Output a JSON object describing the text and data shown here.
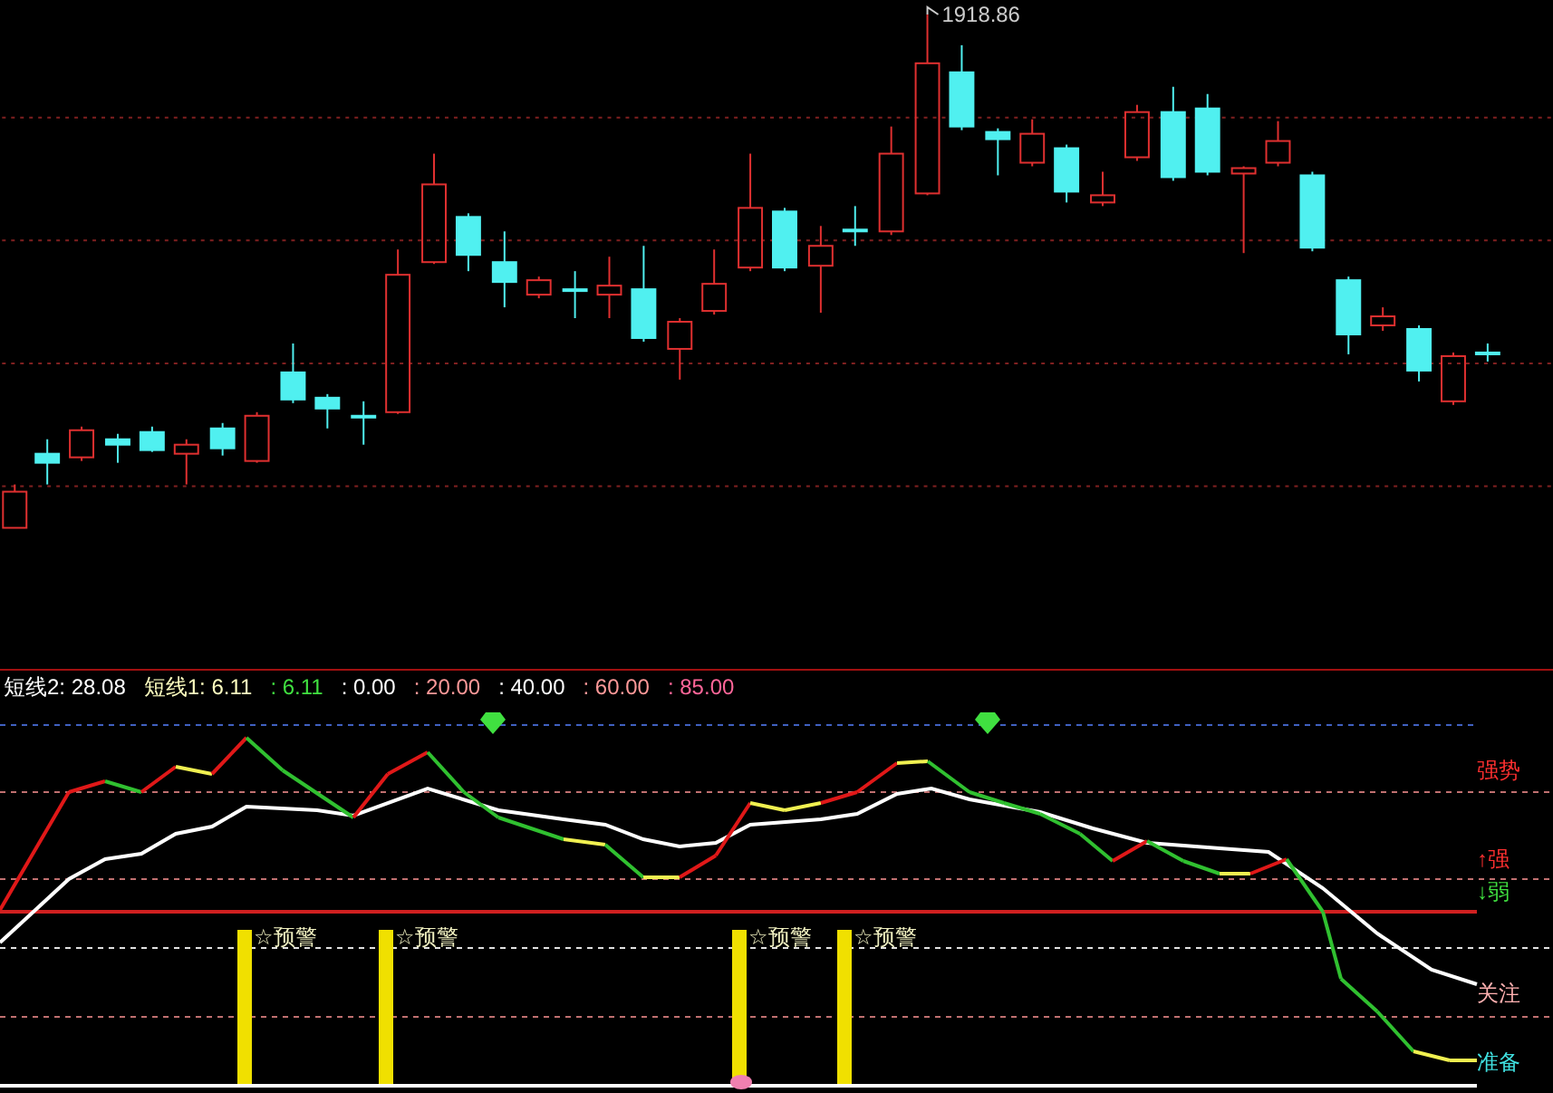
{
  "price_panel": {
    "high_label": "1918.86"
  },
  "indicator": {
    "legend": [
      {
        "text": "短线2: 28.08",
        "color": "#ffffff"
      },
      {
        "text": "短线1: 6.11",
        "color": "#ffffc0"
      },
      {
        "text": ": 6.11",
        "color": "#40e040"
      },
      {
        "text": ": 0.00",
        "color": "#ffffff"
      },
      {
        "text": ": 20.00",
        "color": "#ff9999"
      },
      {
        "text": ": 40.00",
        "color": "#ffffff"
      },
      {
        "text": ": 60.00",
        "color": "#ff9999"
      },
      {
        "text": ": 85.00",
        "color": "#ff6699"
      }
    ],
    "level_labels": [
      {
        "text": "强势",
        "color": "#ff3030"
      },
      {
        "text": "↑强",
        "color": "#ff3030"
      },
      {
        "text": "↓弱",
        "color": "#40e040"
      },
      {
        "text": "关注",
        "color": "#ffb0b0"
      },
      {
        "text": "准备",
        "color": "#40e0e0"
      }
    ],
    "signals": [
      {
        "label": "☆预警"
      },
      {
        "label": "☆预警"
      },
      {
        "label": "☆预警"
      },
      {
        "label": "☆预警"
      }
    ]
  }
}
